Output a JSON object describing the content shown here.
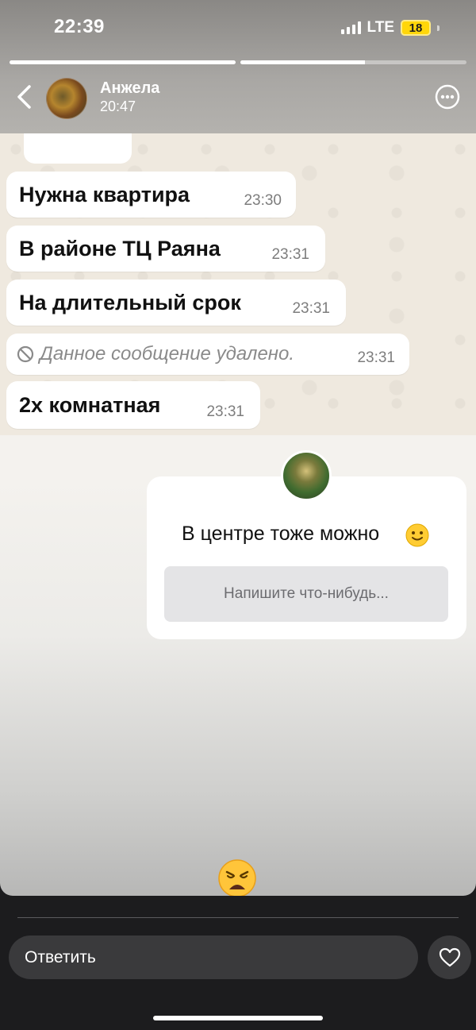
{
  "status_bar": {
    "time": "22:39",
    "network": "LTE",
    "battery": "18"
  },
  "story_progress": [
    1.0,
    0.55
  ],
  "header": {
    "user_name": "Анжела",
    "post_time": "20:47"
  },
  "chat": {
    "messages": [
      {
        "text": "Нужна квартира",
        "time": "23:30"
      },
      {
        "text": "В районе ТЦ Раяна",
        "time": "23:31"
      },
      {
        "text": "На длительный срок",
        "time": "23:31"
      },
      {
        "text": "Данное сообщение удалено.",
        "time": "23:31",
        "deleted": true
      },
      {
        "text": "2х комнатная",
        "time": "23:31"
      }
    ]
  },
  "question_sticker": {
    "question": "В центре тоже можно",
    "placeholder": "Напишите что-нибудь..."
  },
  "reply": {
    "placeholder": "Ответить"
  },
  "colors": {
    "battery": "#ffd60a",
    "bubble": "#ffffff",
    "chat_bg": "#efe9df"
  },
  "icons": [
    "back-icon",
    "more-icon",
    "ban-icon",
    "smile-icon",
    "weary-face-icon",
    "heart-icon"
  ]
}
